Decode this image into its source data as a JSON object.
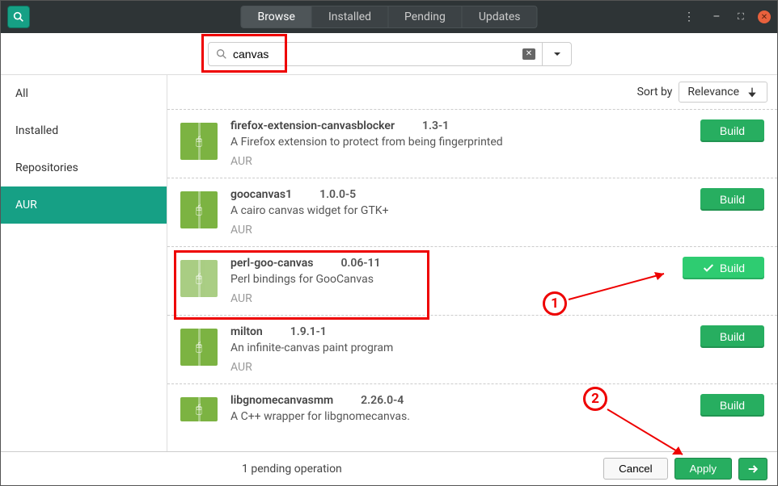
{
  "titlebar": {
    "tabs": [
      "Browse",
      "Installed",
      "Pending",
      "Updates"
    ],
    "active_tab": 0
  },
  "search": {
    "placeholder": "",
    "value": "canvas"
  },
  "sidebar": {
    "items": [
      {
        "label": "All"
      },
      {
        "label": "Installed"
      },
      {
        "label": "Repositories"
      },
      {
        "label": "AUR"
      }
    ],
    "active_index": 3
  },
  "sort": {
    "label": "Sort by",
    "value": "Relevance"
  },
  "packages": [
    {
      "name": "firefox-extension-canvasblocker",
      "version": "1.3-1",
      "desc": "A Firefox extension to protect from being fingerprinted",
      "source": "AUR",
      "button": "Build",
      "selected": false
    },
    {
      "name": "goocanvas1",
      "version": "1.0.0-5",
      "desc": "A cairo canvas widget for GTK+",
      "source": "AUR",
      "button": "Build",
      "selected": false
    },
    {
      "name": "perl-goo-canvas",
      "version": "0.06-11",
      "desc": "Perl bindings for GooCanvas",
      "source": "AUR",
      "button": "Build",
      "selected": true
    },
    {
      "name": "milton",
      "version": "1.9.1-1",
      "desc": "An infinite-canvas paint program",
      "source": "AUR",
      "button": "Build",
      "selected": false
    },
    {
      "name": "libgnomecanvasmm",
      "version": "2.26.0-4",
      "desc": "A C++ wrapper for libgnomecanvas.",
      "source": "AUR",
      "button": "Build",
      "selected": false
    }
  ],
  "footer": {
    "pending": "1 pending operation",
    "cancel": "Cancel",
    "apply": "Apply"
  },
  "annotations": {
    "step1": "1",
    "step2": "2"
  }
}
